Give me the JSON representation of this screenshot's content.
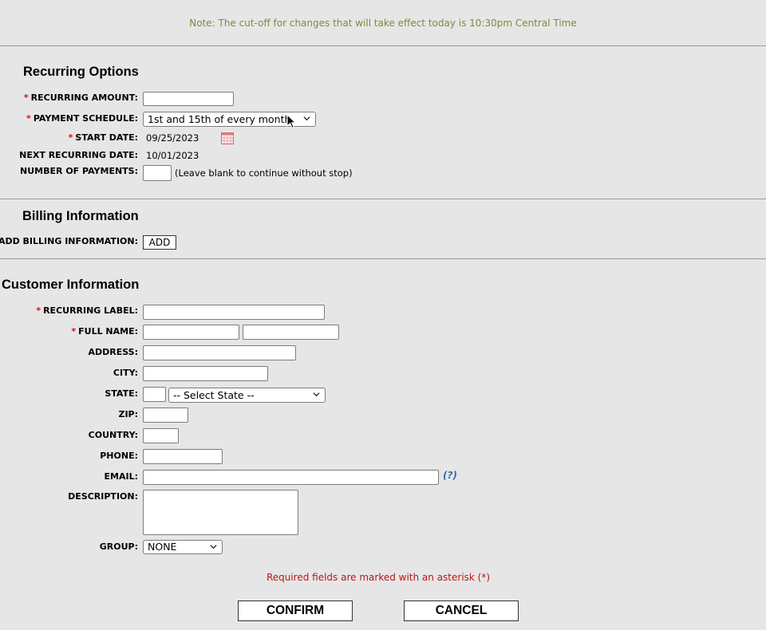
{
  "note": "Note: The cut-off for changes that will take effect today is 10:30pm Central Time",
  "recurring": {
    "title": "Recurring Options",
    "amount_label": "RECURRING AMOUNT:",
    "amount_value": "",
    "schedule_label": "PAYMENT SCHEDULE:",
    "schedule_value": "1st and 15th of every month",
    "start_label": "START DATE:",
    "start_value": "09/25/2023",
    "next_label": "NEXT RECURRING DATE:",
    "next_value": "10/01/2023",
    "payments_label": "NUMBER OF PAYMENTS:",
    "payments_value": "",
    "payments_hint": "(Leave blank to continue without stop)"
  },
  "billing": {
    "title": "Billing Information",
    "add_label": "ADD BILLING INFORMATION:",
    "add_button": "ADD"
  },
  "customer": {
    "title": "Customer Information",
    "label_label": "RECURRING LABEL:",
    "fullname_label": "FULL NAME:",
    "address_label": "ADDRESS:",
    "city_label": "CITY:",
    "state_label": "STATE:",
    "state_select": "-- Select State --",
    "zip_label": "ZIP:",
    "country_label": "COUNTRY:",
    "phone_label": "PHONE:",
    "email_label": "EMAIL:",
    "email_help": "(?)",
    "description_label": "DESCRIPTION:",
    "group_label": "GROUP:",
    "group_value": "NONE"
  },
  "required_note": "Required fields are marked with an asterisk (*)",
  "required_marker": "*",
  "confirm_button": "CONFIRM",
  "cancel_button": "CANCEL",
  "icons": {
    "calendar": "calendar-icon",
    "chevron": "chevron-down-icon",
    "cursor": "mouse-cursor-icon"
  }
}
